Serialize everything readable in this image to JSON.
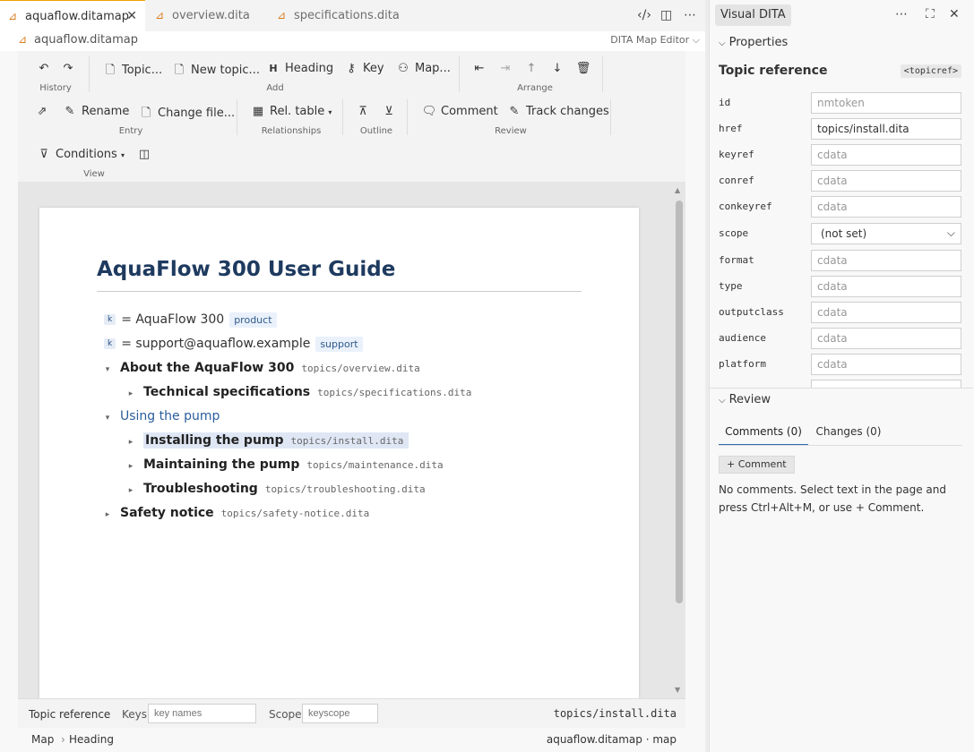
{
  "tabs": [
    {
      "label": "aquaflow.ditamap",
      "active": true
    },
    {
      "label": "overview.dita"
    },
    {
      "label": "specifications.dita"
    }
  ],
  "breadcrumb": {
    "file": "aquaflow.ditamap",
    "editor": "DITA Map Editor"
  },
  "toolbar": {
    "history_label": "History",
    "add_label": "Add",
    "arrange_label": "Arrange",
    "entry_label": "Entry",
    "relationships_label": "Relationships",
    "outline_label": "Outline",
    "review_label": "Review",
    "view_label": "View",
    "topic": "Topic...",
    "new_topic": "New topic...",
    "heading": "Heading",
    "key": "Key",
    "map": "Map...",
    "rename": "Rename",
    "change_file": "Change file...",
    "rel_table": "Rel. table",
    "comment": "Comment",
    "track_changes": "Track changes",
    "conditions": "Conditions"
  },
  "doc": {
    "title": "AquaFlow 300 User Guide",
    "keys": [
      {
        "badge": "k",
        "text": "= AquaFlow 300",
        "tag": "product"
      },
      {
        "badge": "k",
        "text": "= support@aquaflow.example",
        "tag": "support"
      }
    ],
    "nodes": [
      {
        "twisty": "▾",
        "label": "About the AquaFlow 300",
        "href": "topics/overview.dita"
      },
      {
        "twisty": "▸",
        "label": "Technical specifications",
        "href": "topics/specifications.dita"
      },
      {
        "twisty": "▾",
        "label": "Using the pump",
        "href": ""
      },
      {
        "twisty": "▸",
        "label": "Installing the pump",
        "href": "topics/install.dita"
      },
      {
        "twisty": "▸",
        "label": "Maintaining the pump",
        "href": "topics/maintenance.dita"
      },
      {
        "twisty": "▸",
        "label": "Troubleshooting",
        "href": "topics/troubleshooting.dita"
      },
      {
        "twisty": "▸",
        "label": "Safety notice",
        "href": "topics/safety-notice.dita"
      }
    ]
  },
  "status": {
    "type": "Topic reference",
    "keys_label": "Keys",
    "keys_placeholder": "key names",
    "scope_label": "Scope",
    "scope_placeholder": "keyscope",
    "href": "topics/install.dita"
  },
  "footer": {
    "crumb1": "Map",
    "crumb2": "Heading",
    "right": "aquaflow.ditamap · map"
  },
  "panel": {
    "title": "Visual DITA",
    "properties_label": "Properties",
    "element_name": "Topic reference",
    "element_tag": "<topicref>",
    "props": [
      {
        "name": "id",
        "value": "",
        "placeholder": "nmtoken"
      },
      {
        "name": "href",
        "value": "topics/install.dita",
        "placeholder": ""
      },
      {
        "name": "keyref",
        "value": "",
        "placeholder": "cdata"
      },
      {
        "name": "conref",
        "value": "",
        "placeholder": "cdata"
      },
      {
        "name": "conkeyref",
        "value": "",
        "placeholder": "cdata"
      },
      {
        "name": "scope",
        "value": "(not set)",
        "placeholder": ""
      },
      {
        "name": "format",
        "value": "",
        "placeholder": "cdata"
      },
      {
        "name": "type",
        "value": "",
        "placeholder": "cdata"
      },
      {
        "name": "outputclass",
        "value": "",
        "placeholder": "cdata"
      },
      {
        "name": "audience",
        "value": "",
        "placeholder": "cdata"
      },
      {
        "name": "platform",
        "value": "",
        "placeholder": "cdata"
      }
    ],
    "review_label": "Review",
    "comments_tab": "Comments (0)",
    "changes_tab": "Changes (0)",
    "add_comment": "+ Comment",
    "empty_text": "No comments. Select text in the page and press Ctrl+Alt+M, or use + Comment."
  }
}
